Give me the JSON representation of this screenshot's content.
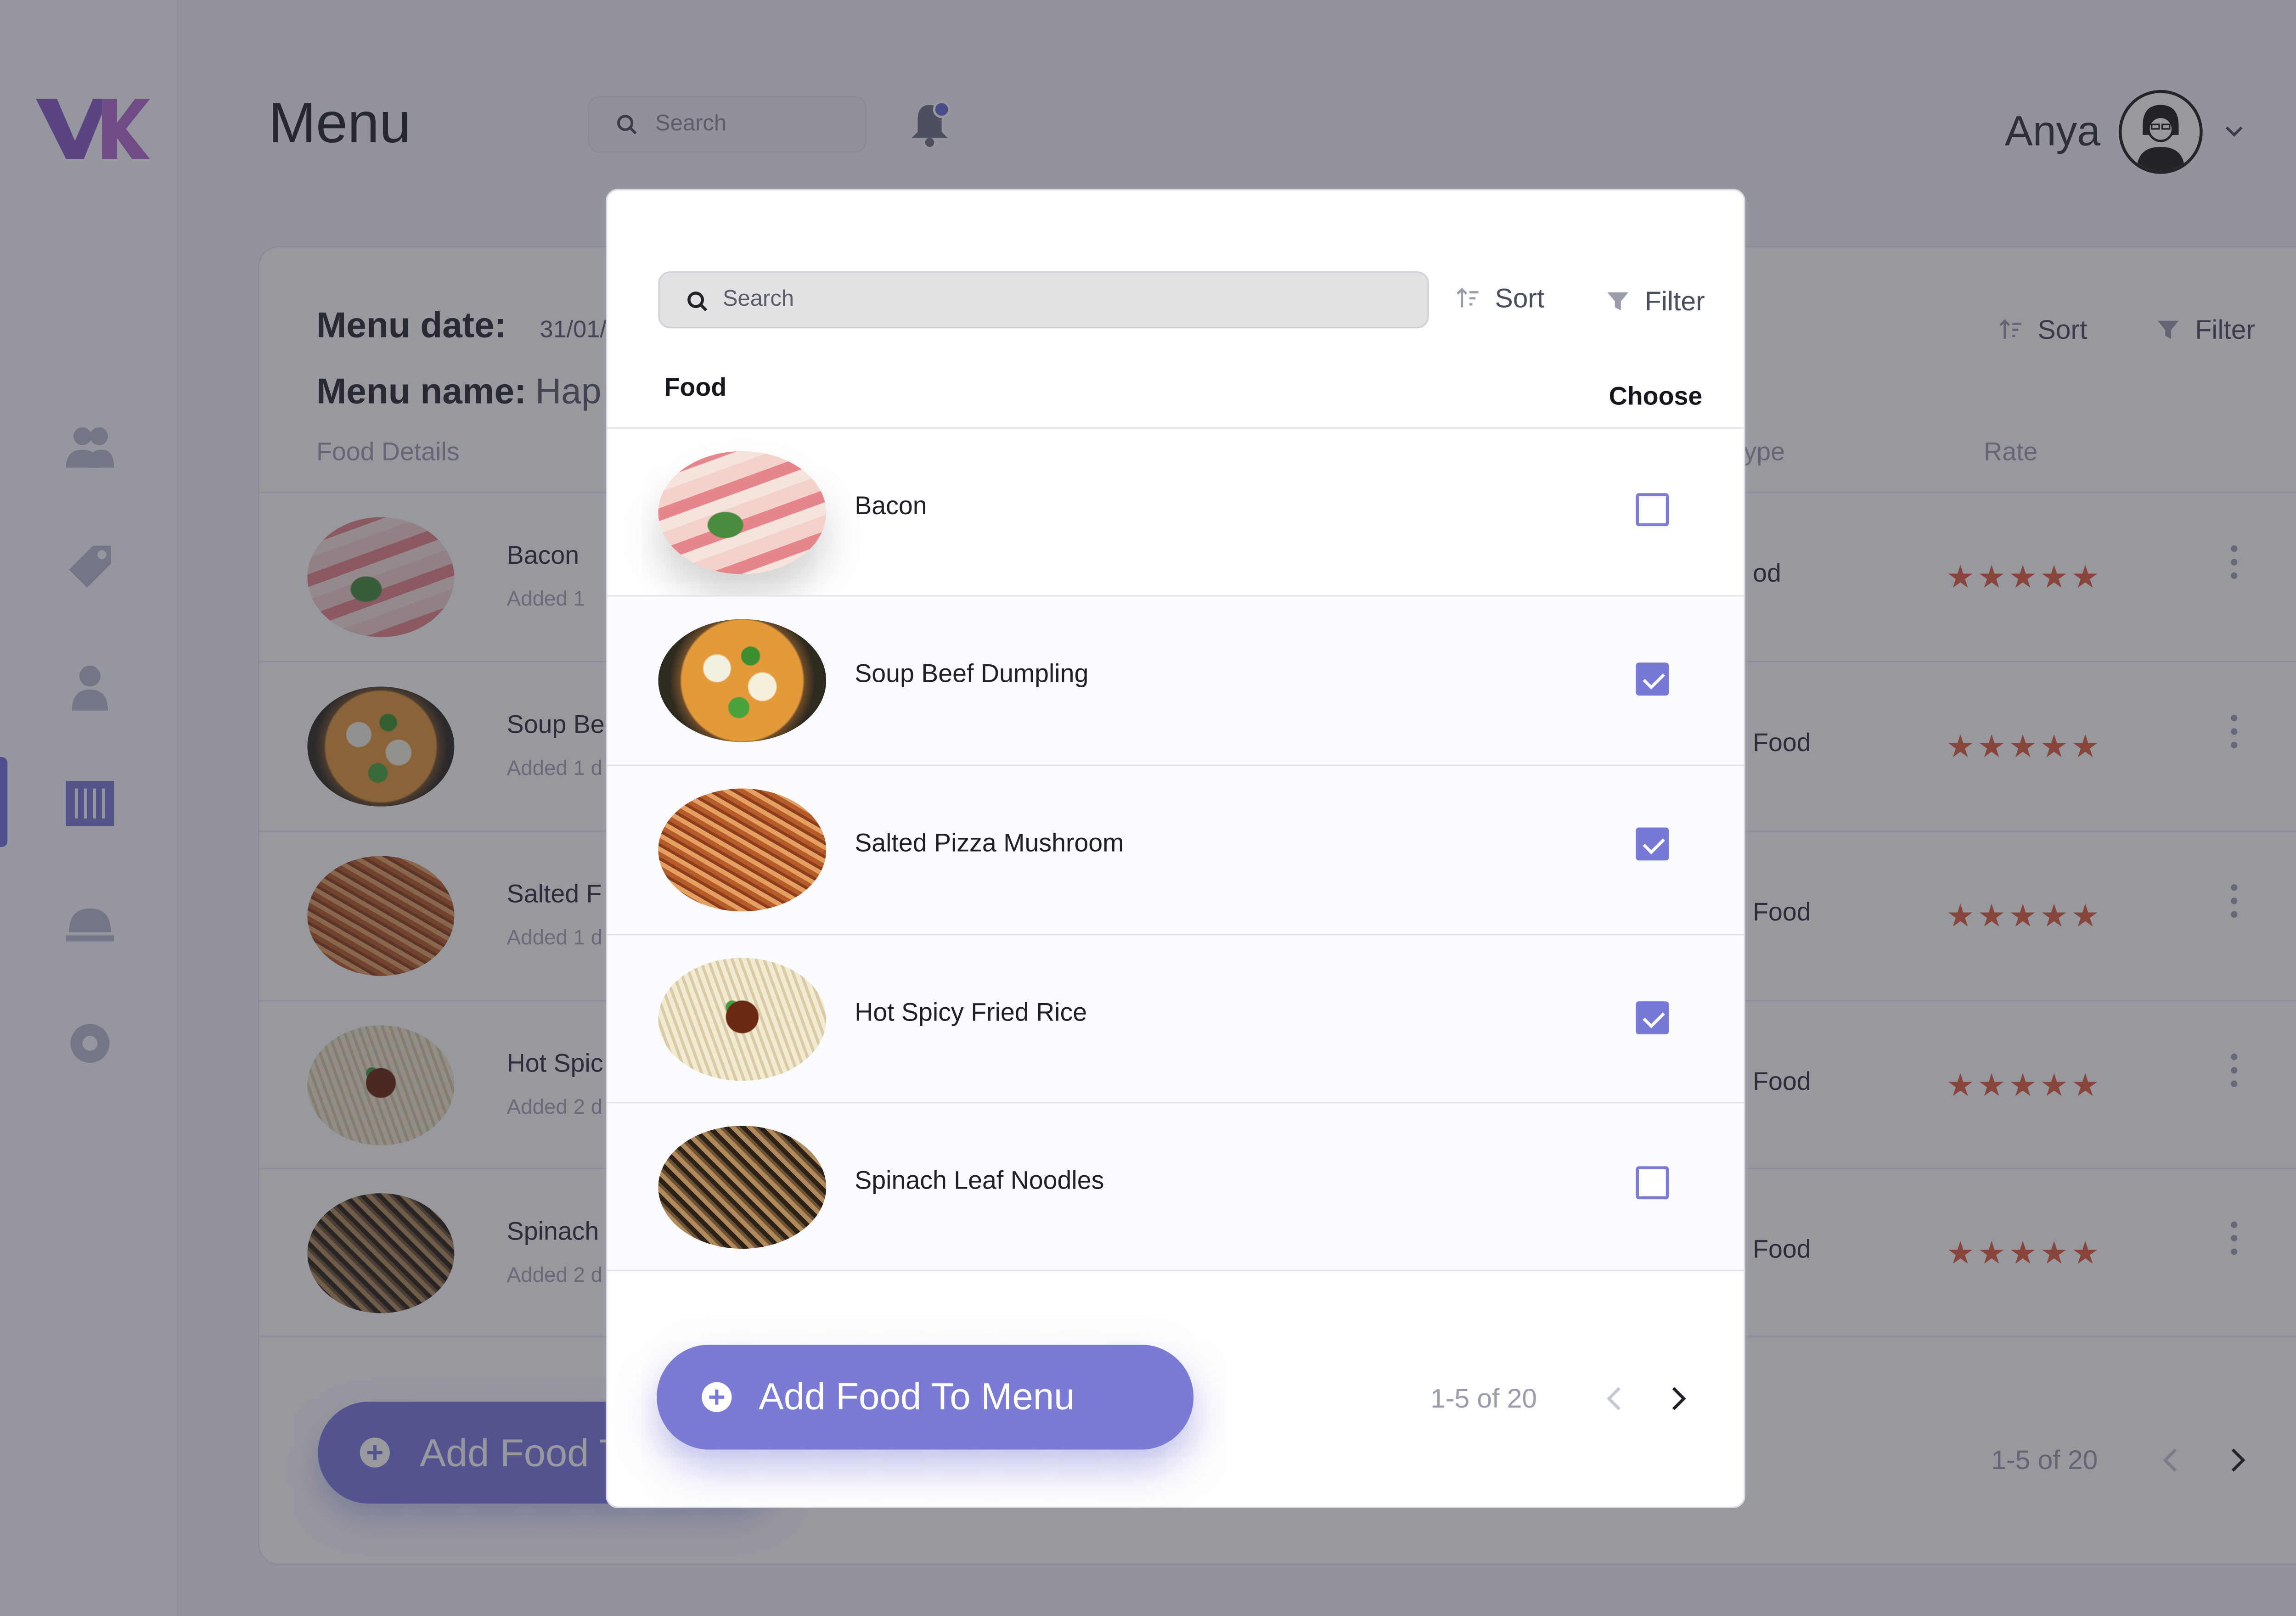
{
  "app": {
    "page_title": "Menu",
    "search_placeholder": "Search",
    "user_name": "Anya"
  },
  "menu_card": {
    "menu_date_label": "Menu date:",
    "menu_date_value": "31/01/",
    "menu_name_label": "Menu name:",
    "menu_name_value": "Hap",
    "columns": {
      "food_details": "Food Details",
      "type": "ype",
      "rate": "Rate"
    },
    "sort_label": "Sort",
    "filter_label": "Filter",
    "rows": [
      {
        "name": "Bacon",
        "added": "Added 1",
        "type": "od",
        "stars": "★★★★★"
      },
      {
        "name": "Soup Be",
        "added": "Added 1 d",
        "type": "Food",
        "stars": "★★★★★"
      },
      {
        "name": "Salted F",
        "added": "Added 1 d",
        "type": "Food",
        "stars": "★★★★★"
      },
      {
        "name": "Hot Spic",
        "added": "Added 2 d",
        "type": "Food",
        "stars": "★★★★★"
      },
      {
        "name": "Spinach",
        "added": "Added 2 d",
        "type": "Food",
        "stars": "★★★★★"
      }
    ],
    "add_button_label": "Add Food T",
    "pager": "1-5 of 20"
  },
  "modal": {
    "search_placeholder": "Search",
    "sort_label": "Sort",
    "filter_label": "Filter",
    "col_food": "Food",
    "col_choose": "Choose",
    "items": [
      {
        "name": "Bacon",
        "checked": false
      },
      {
        "name": "Soup Beef Dumpling",
        "checked": true
      },
      {
        "name": "Salted Pizza Mushroom",
        "checked": true
      },
      {
        "name": "Hot Spicy Fried Rice",
        "checked": true
      },
      {
        "name": "Spinach Leaf Noodles",
        "checked": false
      }
    ],
    "add_button_label": "Add Food To Menu",
    "pager": "1-5 of 20"
  },
  "colors": {
    "accent": "#7b7bd6",
    "star": "#e15f42",
    "logo": "#8a5cc8"
  },
  "icons": [
    "logo-icon",
    "users-icon",
    "tag-icon",
    "chef-icon",
    "menu-icon",
    "serving-icon",
    "settings-icon",
    "search-icon",
    "bell-icon",
    "chevron-down-icon",
    "sort-icon",
    "filter-icon",
    "plus-circle-icon",
    "chevron-left-icon",
    "chevron-right-icon",
    "kebab-icon"
  ]
}
